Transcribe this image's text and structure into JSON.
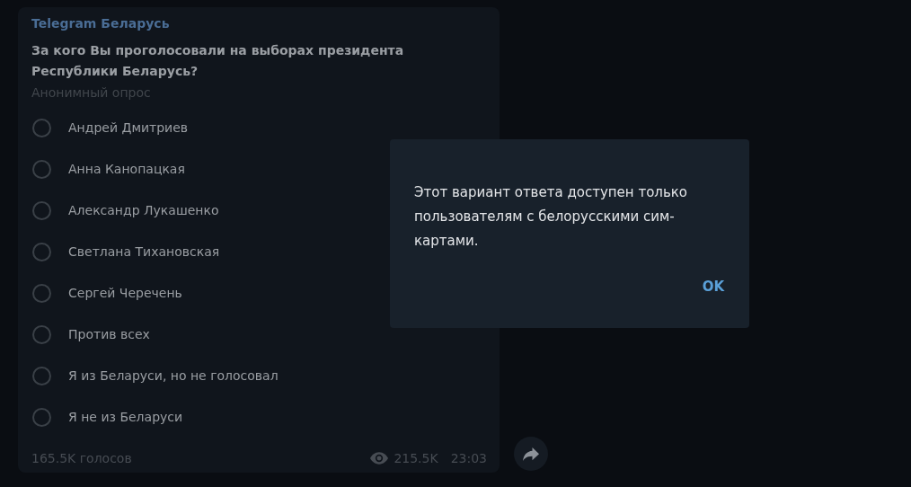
{
  "poll": {
    "channel": "Telegram Беларусь",
    "question": "За кого Вы проголосовали на выборах президента Республики Беларусь?",
    "type": "Анонимный опрос",
    "options": [
      {
        "label": "Андрей Дмитриев",
        "selected": false
      },
      {
        "label": "Анна Канопацкая",
        "selected": false
      },
      {
        "label": "Александр Лукашенко",
        "selected": false
      },
      {
        "label": "Светлана Тихановская",
        "selected": false
      },
      {
        "label": "Сергей Черечень",
        "selected": false
      },
      {
        "label": "Против всех",
        "selected": false
      },
      {
        "label": "Я из Беларуси, но не голосовал",
        "selected": false
      },
      {
        "label": "Я не из Беларуси",
        "selected": false
      }
    ],
    "votes": "165.5K голосов",
    "views": "215.5K",
    "time": "23:03"
  },
  "dialog": {
    "message": "Этот вариант ответа доступен только пользователям с белорусскими сим-картами.",
    "button": "OK"
  }
}
